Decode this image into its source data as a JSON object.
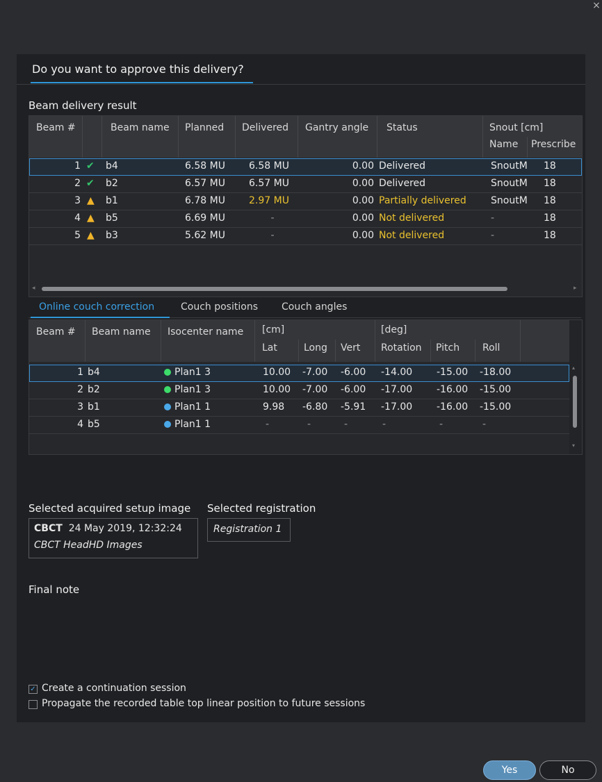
{
  "close_glyph": "×",
  "dialog": {
    "question": "Do you want to approve this delivery?"
  },
  "beam_result": {
    "title": "Beam delivery result",
    "headers": {
      "beam_num": "Beam #",
      "beam_name": "Beam name",
      "planned": "Planned",
      "delivered": "Delivered",
      "gantry": "Gantry angle",
      "status": "Status",
      "snout": "Snout [cm]",
      "snout_name": "Name",
      "snout_prescribed": "Prescribe"
    },
    "rows": [
      {
        "num": "1",
        "icon": "check",
        "name": "b4",
        "planned": "6.58 MU",
        "delivered": "6.58 MU",
        "gantry": "0.00",
        "status": "Delivered",
        "snout": "SnoutM",
        "pres": "18"
      },
      {
        "num": "2",
        "icon": "check",
        "name": "b2",
        "planned": "6.57 MU",
        "delivered": "6.57 MU",
        "gantry": "0.00",
        "status": "Delivered",
        "snout": "SnoutM",
        "pres": "18"
      },
      {
        "num": "3",
        "icon": "warning",
        "name": "b1",
        "planned": "6.78 MU",
        "delivered": "2.97 MU",
        "gantry": "0.00",
        "status": "Partially delivered",
        "snout": "SnoutM",
        "pres": "18"
      },
      {
        "num": "4",
        "icon": "warning",
        "name": "b5",
        "planned": "6.69 MU",
        "delivered": "-",
        "gantry": "0.00",
        "status": "Not delivered",
        "snout": "-",
        "pres": "18"
      },
      {
        "num": "5",
        "icon": "warning",
        "name": "b3",
        "planned": "5.62 MU",
        "delivered": "-",
        "gantry": "0.00",
        "status": "Not delivered",
        "snout": "-",
        "pres": "18"
      }
    ],
    "glyphs": {
      "check": "✔",
      "warning": "▲",
      "left": "◂",
      "right": "▸"
    }
  },
  "tabs": [
    "Online couch correction",
    "Couch positions",
    "Couch angles"
  ],
  "couch": {
    "headers": {
      "beam_num": "Beam #",
      "beam_name": "Beam name",
      "isocenter": "Isocenter name",
      "cm": "[cm]",
      "lat": "Lat",
      "long": "Long",
      "vert": "Vert",
      "deg": "[deg]",
      "rotation": "Rotation",
      "pitch": "Pitch",
      "roll": "Roll"
    },
    "rows": [
      {
        "num": "1",
        "name": "b4",
        "iso": "Plan1 3",
        "dot": "#3ddc6a",
        "lat": "10.00",
        "long": "-7.00",
        "vert": "-6.00",
        "rot": "-14.00",
        "pitch": "-15.00",
        "roll": "-18.00"
      },
      {
        "num": "2",
        "name": "b2",
        "iso": "Plan1 3",
        "dot": "#3ddc6a",
        "lat": "10.00",
        "long": "-7.00",
        "vert": "-6.00",
        "rot": "-17.00",
        "pitch": "-16.00",
        "roll": "-15.00"
      },
      {
        "num": "3",
        "name": "b1",
        "iso": "Plan1 1",
        "dot": "#4aa8e8",
        "lat": "9.98",
        "long": "-6.80",
        "vert": "-5.91",
        "rot": "-17.00",
        "pitch": "-16.00",
        "roll": "-15.00"
      },
      {
        "num": "4",
        "name": "b5",
        "iso": "Plan1 1",
        "dot": "#4aa8e8",
        "lat": "-",
        "long": "-",
        "vert": "-",
        "rot": "-",
        "pitch": "-",
        "roll": "-"
      }
    ],
    "glyphs": {
      "up": "▴",
      "down": "▾"
    }
  },
  "setup": {
    "image_title": "Selected acquired setup image",
    "reg_title": "Selected registration",
    "modality": "CBCT",
    "datetime": "24 May 2019, 12:32:24",
    "image_name": "CBCT HeadHD Images",
    "registration": "Registration 1"
  },
  "final_note": "Final note",
  "options": {
    "continuation": {
      "label": "Create a continuation session",
      "checked": true,
      "glyph": "✓"
    },
    "propagate": {
      "label": "Propagate the recorded table top linear position to future sessions",
      "checked": false
    }
  },
  "buttons": {
    "yes": "Yes",
    "no": "No"
  }
}
